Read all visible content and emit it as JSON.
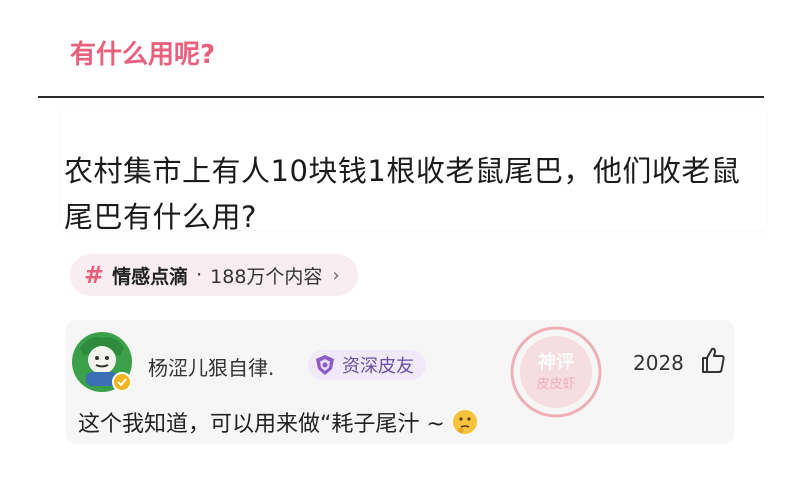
{
  "header": {
    "title": "有什么用呢?"
  },
  "question": {
    "text": "农村集市上有人10块钱1根收老鼠尾巴，他们收老鼠尾巴有什么用?"
  },
  "topic": {
    "hash": "#",
    "name": "情感点滴",
    "separator": "·",
    "count": "188万个内容",
    "chevron": "›"
  },
  "comment": {
    "username": "杨涩儿狠自律.",
    "badge": "资深皮友",
    "likes": "2028",
    "text": "这个我知道，可以用来做“耗子尾汁 ~",
    "watermark": "神评 皮皮虾"
  },
  "colors": {
    "accent": "#e8607c",
    "badge": "#6b4ea3",
    "watermark": "#e86a7a"
  },
  "icons": {
    "like": "thumbs-up-icon",
    "badge": "shield-icon",
    "emoji": "thinking-face-icon"
  }
}
